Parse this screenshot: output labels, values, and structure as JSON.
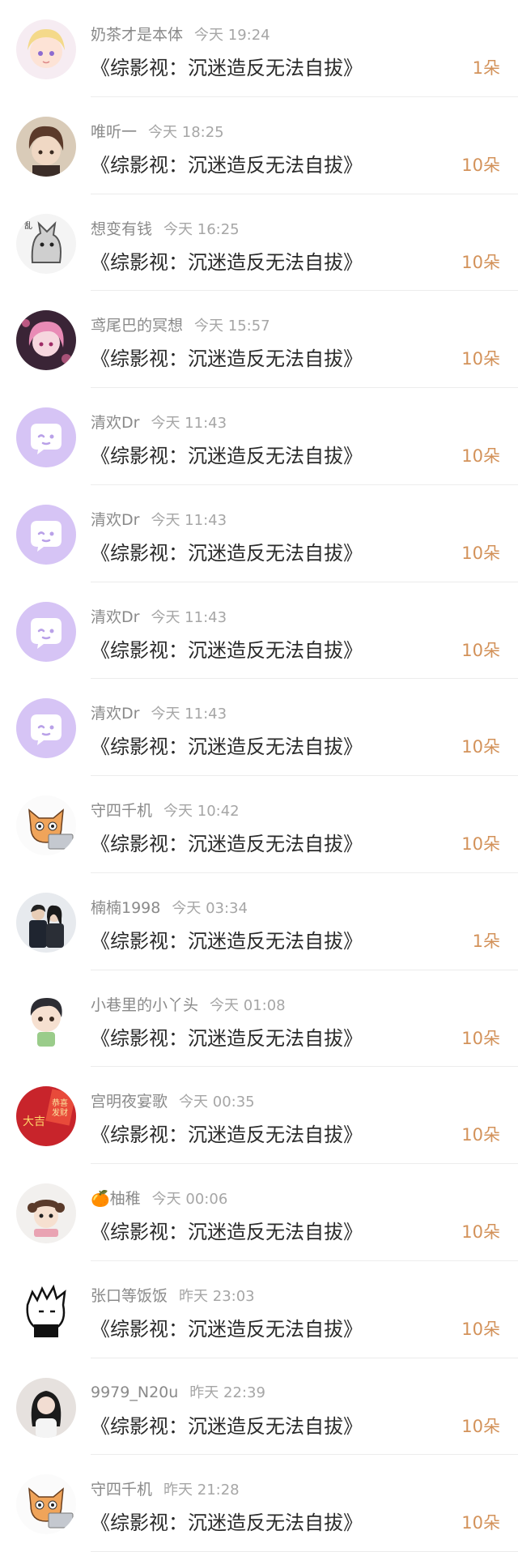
{
  "accent_color": "#d3925a",
  "placeholder_avatar_color": "#cfb6f0",
  "records": [
    {
      "name": "奶茶才是本体",
      "time": "今天 19:24",
      "title": "《综影视：沉迷造反无法自拔》",
      "amount": "1朵",
      "avatar": "anime-girl-avatar"
    },
    {
      "name": "唯听一",
      "time": "今天 18:25",
      "title": "《综影视：沉迷造反无法自拔》",
      "amount": "10朵",
      "avatar": "anime-boy-avatar"
    },
    {
      "name": "想变有钱",
      "time": "今天 16:25",
      "title": "《综影视：沉迷造反无法自拔》",
      "amount": "10朵",
      "avatar": "ink-wolf-avatar"
    },
    {
      "name": "鸢尾巴的冥想",
      "time": "今天 15:57",
      "title": "《综影视：沉迷造反无法自拔》",
      "amount": "10朵",
      "avatar": "pink-anime-avatar"
    },
    {
      "name": "清欢Dr",
      "time": "今天 11:43",
      "title": "《综影视：沉迷造反无法自拔》",
      "amount": "10朵",
      "avatar": "default-chat-avatar"
    },
    {
      "name": "清欢Dr",
      "time": "今天 11:43",
      "title": "《综影视：沉迷造反无法自拔》",
      "amount": "10朵",
      "avatar": "default-chat-avatar"
    },
    {
      "name": "清欢Dr",
      "time": "今天 11:43",
      "title": "《综影视：沉迷造反无法自拔》",
      "amount": "10朵",
      "avatar": "default-chat-avatar"
    },
    {
      "name": "清欢Dr",
      "time": "今天 11:43",
      "title": "《综影视：沉迷造反无法自拔》",
      "amount": "10朵",
      "avatar": "default-chat-avatar"
    },
    {
      "name": "守四千机",
      "time": "今天 10:42",
      "title": "《综影视：沉迷造反无法自拔》",
      "amount": "10朵",
      "avatar": "cat-laptop-avatar"
    },
    {
      "name": "楠楠1998",
      "time": "今天 03:34",
      "title": "《综影视：沉迷造反无法自拔》",
      "amount": "1朵",
      "avatar": "couple-photo-avatar"
    },
    {
      "name": "小巷里的小丫头",
      "time": "今天 01:08",
      "title": "《综影视：沉迷造反无法自拔》",
      "amount": "10朵",
      "avatar": "chibi-boy-avatar"
    },
    {
      "name": "宫明夜宴歌",
      "time": "今天 00:35",
      "title": "《综影视：沉迷造反无法自拔》",
      "amount": "10朵",
      "avatar": "red-banner-avatar"
    },
    {
      "name": "🍊柚稚",
      "time": "今天 00:06",
      "title": "《综影视：沉迷造反无法自拔》",
      "amount": "10朵",
      "avatar": "chibi-girl-avatar"
    },
    {
      "name": "张口等饭饭",
      "time": "昨天 23:03",
      "title": "《综影视：沉迷造反无法自拔》",
      "amount": "10朵",
      "avatar": "sketch-boy-avatar"
    },
    {
      "name": "9979_N20u",
      "time": "昨天 22:39",
      "title": "《综影视：沉迷造反无法自拔》",
      "amount": "10朵",
      "avatar": "girl-photo-avatar"
    },
    {
      "name": "守四千机",
      "time": "昨天 21:28",
      "title": "《综影视：沉迷造反无法自拔》",
      "amount": "10朵",
      "avatar": "cat-laptop-avatar"
    }
  ]
}
